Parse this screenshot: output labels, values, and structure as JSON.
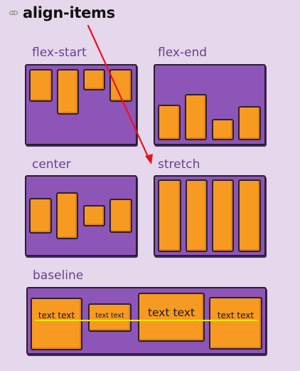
{
  "heading": {
    "title": "align-items",
    "icon": "link-icon"
  },
  "colors": {
    "page_background": "#e6d8ec",
    "container": "#8d55b7",
    "item": "#f79a22",
    "label": "#6b3d8c",
    "arrow": "#e8141b",
    "baseline": "#f2e600"
  },
  "diagrams": {
    "flex_start": {
      "label": "flex-start"
    },
    "flex_end": {
      "label": "flex-end"
    },
    "center": {
      "label": "center"
    },
    "stretch": {
      "label": "stretch"
    },
    "baseline": {
      "label": "baseline",
      "items": [
        {
          "text": "text text"
        },
        {
          "text": "text text"
        },
        {
          "text": "text text"
        },
        {
          "text": "text text"
        }
      ]
    }
  }
}
